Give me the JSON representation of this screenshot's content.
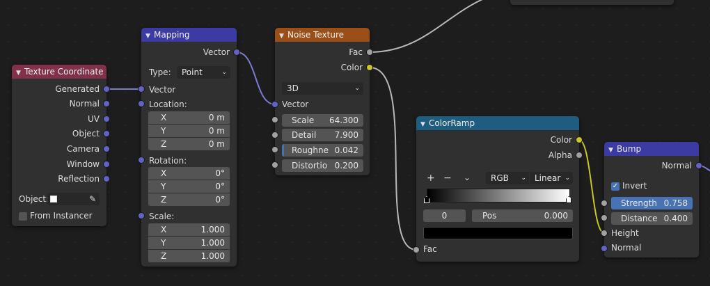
{
  "colors": {
    "background": "#1d1d1d",
    "node_body": "#303030",
    "header_texture_coordinate": "#83314a",
    "header_mapping": "#3b3ba3",
    "header_noise_texture": "#9b4f18",
    "header_colorramp": "#1f5d80",
    "header_bump": "#3b3ba3",
    "socket_vector": "#6363c7",
    "socket_float": "#a1a1a1",
    "socket_color": "#c7c729"
  },
  "texture_coordinate": {
    "title": "Texture Coordinate",
    "outputs": [
      "Generated",
      "Normal",
      "UV",
      "Object",
      "Camera",
      "Window",
      "Reflection"
    ],
    "object_label": "Object:",
    "from_instancer": "From Instancer"
  },
  "mapping": {
    "title": "Mapping",
    "output_vector": "Vector",
    "type_label": "Type:",
    "type_value": "Point",
    "input_vector": "Vector",
    "location_label": "Location:",
    "location": [
      {
        "axis": "X",
        "value": "0 m"
      },
      {
        "axis": "Y",
        "value": "0 m"
      },
      {
        "axis": "Z",
        "value": "0 m"
      }
    ],
    "rotation_label": "Rotation:",
    "rotation": [
      {
        "axis": "X",
        "value": "0°"
      },
      {
        "axis": "Y",
        "value": "0°"
      },
      {
        "axis": "Z",
        "value": "0°"
      }
    ],
    "scale_label": "Scale:",
    "scale": [
      {
        "axis": "X",
        "value": "1.000"
      },
      {
        "axis": "Y",
        "value": "1.000"
      },
      {
        "axis": "Z",
        "value": "1.000"
      }
    ]
  },
  "noise_texture": {
    "title": "Noise Texture",
    "output_fac": "Fac",
    "output_color": "Color",
    "dimensions": "3D",
    "input_vector": "Vector",
    "fields": [
      {
        "label": "Scale",
        "value": "64.300"
      },
      {
        "label": "Detail",
        "value": "7.900"
      },
      {
        "label": "Roughne",
        "value": "0.042"
      },
      {
        "label": "Distortio",
        "value": "0.200"
      }
    ]
  },
  "colorramp": {
    "title": "ColorRamp",
    "output_color": "Color",
    "output_alpha": "Alpha",
    "add_symbol": "+",
    "remove_symbol": "−",
    "color_mode": "RGB",
    "interpolation": "Linear",
    "stop_index": "0",
    "pos_label": "Pos",
    "pos_value": "0.000",
    "input_fac": "Fac"
  },
  "bump": {
    "title": "Bump",
    "output_normal": "Normal",
    "invert_label": "Invert",
    "strength_label": "Strength",
    "strength_value": "0.758",
    "distance_label": "Distance",
    "distance_value": "0.400",
    "input_height": "Height",
    "input_normal": "Normal"
  }
}
